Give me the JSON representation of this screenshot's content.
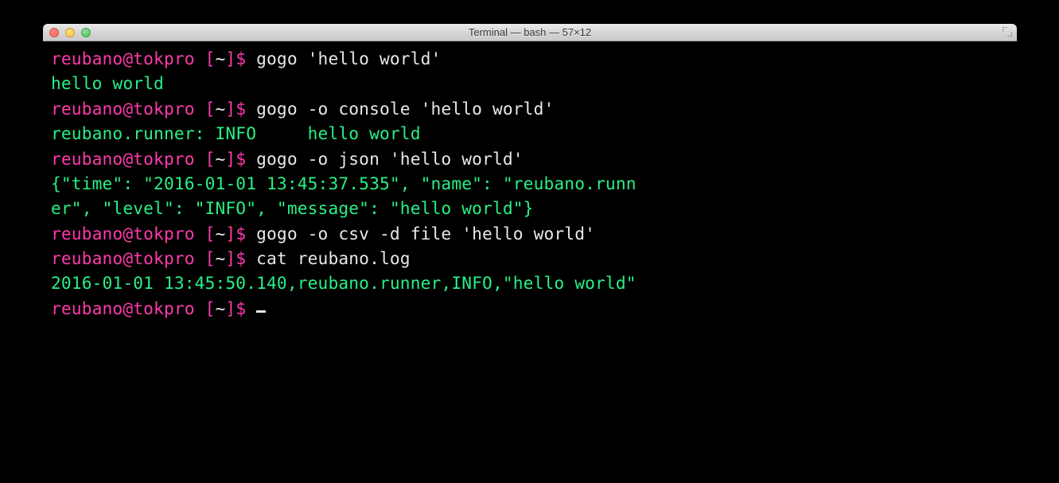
{
  "window": {
    "title": "Terminal — bash — 57×12"
  },
  "prompt": {
    "user": "reubano",
    "at": "@",
    "host": "tokpro",
    "path_open": " [",
    "path": "~",
    "path_close": "]",
    "symbol": "$ "
  },
  "lines": [
    {
      "cmd": "gogo 'hello world'"
    },
    {
      "out": "hello world"
    },
    {
      "cmd": "gogo -o console 'hello world'"
    },
    {
      "out": "reubano.runner: INFO     hello world"
    },
    {
      "cmd": "gogo -o json 'hello world'"
    },
    {
      "out": "{\"time\": \"2016-01-01 13:45:37.535\", \"name\": \"reubano.runn"
    },
    {
      "out": "er\", \"level\": \"INFO\", \"message\": \"hello world\"}"
    },
    {
      "cmd": "gogo -o csv -d file 'hello world'"
    },
    {
      "cmd": "cat reubano.log"
    },
    {
      "out": "2016-01-01 13:45:50.140,reubano.runner,INFO,\"hello world\""
    }
  ],
  "colors": {
    "bg": "#000000",
    "fg": "#e8e8e8",
    "accent_user": "#ff3aad",
    "accent_output": "#29f085"
  }
}
